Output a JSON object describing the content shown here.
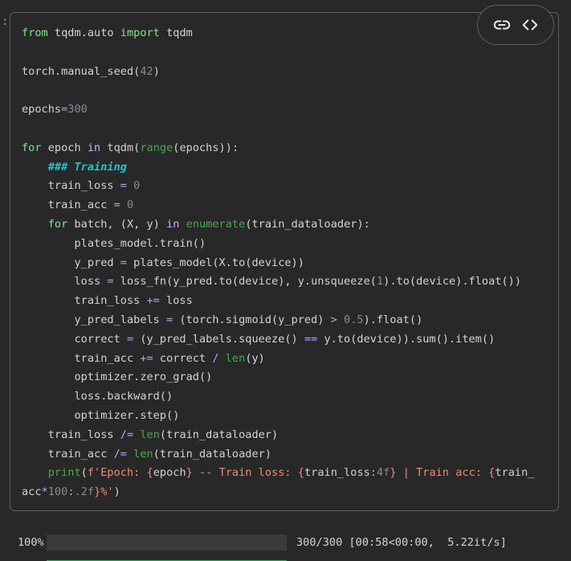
{
  "cell": {
    "prompt": ":",
    "lines": [
      [
        [
          "kw",
          "from"
        ],
        [
          "id",
          " tqdm.auto "
        ],
        [
          "kw",
          "import"
        ],
        [
          "id",
          " tqdm"
        ]
      ],
      [],
      [
        [
          "id",
          "torch.manual_seed("
        ],
        [
          "num",
          "42"
        ],
        [
          "id",
          ")"
        ]
      ],
      [],
      [
        [
          "id",
          "epochs"
        ],
        [
          "op",
          "="
        ],
        [
          "num",
          "300"
        ]
      ],
      [],
      [
        [
          "kw",
          "for"
        ],
        [
          "id",
          " epoch "
        ],
        [
          "kw2",
          "in"
        ],
        [
          "id",
          " tqdm("
        ],
        [
          "bi",
          "range"
        ],
        [
          "id",
          "(epochs)):"
        ]
      ],
      [
        [
          "id",
          "    "
        ],
        [
          "com",
          "### Training"
        ]
      ],
      [
        [
          "id",
          "    train_loss "
        ],
        [
          "op",
          "="
        ],
        [
          "id",
          " "
        ],
        [
          "num",
          "0"
        ]
      ],
      [
        [
          "id",
          "    train_acc "
        ],
        [
          "op",
          "="
        ],
        [
          "id",
          " "
        ],
        [
          "num",
          "0"
        ]
      ],
      [
        [
          "id",
          "    "
        ],
        [
          "kw",
          "for"
        ],
        [
          "id",
          " batch, (X, y) "
        ],
        [
          "kw2",
          "in"
        ],
        [
          "id",
          " "
        ],
        [
          "bi",
          "enumerate"
        ],
        [
          "id",
          "(train_dataloader):"
        ]
      ],
      [
        [
          "id",
          "        plates_model.train()"
        ]
      ],
      [
        [
          "id",
          "        y_pred "
        ],
        [
          "op",
          "="
        ],
        [
          "id",
          " plates_model(X.to(device))"
        ]
      ],
      [
        [
          "id",
          "        loss "
        ],
        [
          "op",
          "="
        ],
        [
          "id",
          " loss_fn(y_pred.to(device), y.unsqueeze("
        ],
        [
          "num",
          "1"
        ],
        [
          "id",
          ").to(device).float())"
        ]
      ],
      [
        [
          "id",
          "        train_loss "
        ],
        [
          "op",
          "+="
        ],
        [
          "id",
          " loss"
        ]
      ],
      [
        [
          "id",
          "        y_pred_labels "
        ],
        [
          "op",
          "="
        ],
        [
          "id",
          " (torch.sigmoid(y_pred) "
        ],
        [
          "op",
          ">"
        ],
        [
          "id",
          " "
        ],
        [
          "num",
          "0.5"
        ],
        [
          "id",
          ").float()"
        ]
      ],
      [
        [
          "id",
          "        correct "
        ],
        [
          "op",
          "="
        ],
        [
          "id",
          " (y_pred_labels.squeeze() "
        ],
        [
          "op",
          "=="
        ],
        [
          "id",
          " y.to(device)).sum().item()"
        ]
      ],
      [
        [
          "id",
          "        train_acc "
        ],
        [
          "op",
          "+="
        ],
        [
          "id",
          " correct "
        ],
        [
          "op",
          "/"
        ],
        [
          "id",
          " "
        ],
        [
          "bi",
          "len"
        ],
        [
          "id",
          "(y)"
        ]
      ],
      [
        [
          "id",
          "        optimizer.zero_grad()"
        ]
      ],
      [
        [
          "id",
          "        loss.backward()"
        ]
      ],
      [
        [
          "id",
          "        optimizer.step()"
        ]
      ],
      [
        [
          "id",
          "    train_loss "
        ],
        [
          "op",
          "/="
        ],
        [
          "id",
          " "
        ],
        [
          "bi",
          "len"
        ],
        [
          "id",
          "(train_dataloader)"
        ]
      ],
      [
        [
          "id",
          "    train_acc "
        ],
        [
          "op",
          "/="
        ],
        [
          "id",
          " "
        ],
        [
          "bi",
          "len"
        ],
        [
          "id",
          "(train_dataloader)"
        ]
      ],
      [
        [
          "id",
          "    "
        ],
        [
          "bi",
          "print"
        ],
        [
          "id",
          "("
        ],
        [
          "str",
          "f'Epoch: "
        ],
        [
          "str",
          "{"
        ],
        [
          "id",
          "epoch"
        ],
        [
          "str",
          "}"
        ],
        [
          "str",
          " -- Train loss: "
        ],
        [
          "str",
          "{"
        ],
        [
          "id",
          "train_loss"
        ],
        [
          "op",
          ":"
        ],
        [
          "num",
          "4f"
        ],
        [
          "str",
          "}"
        ],
        [
          "str",
          " | Train acc: "
        ],
        [
          "str",
          "{"
        ],
        [
          "id",
          "train_"
        ]
      ],
      [
        [
          "id",
          "acc"
        ],
        [
          "op",
          "*"
        ],
        [
          "num",
          "100"
        ],
        [
          "op",
          ":"
        ],
        [
          "num",
          ".2f"
        ],
        [
          "str",
          "}"
        ],
        [
          "str",
          "%'"
        ],
        [
          "id",
          ")"
        ]
      ]
    ]
  },
  "toolbar": {
    "link_icon": "link-icon",
    "code_icon": "code-icon"
  },
  "output": {
    "percent": "100%",
    "progress_fraction": 1.0,
    "stats": "300/300 [00:58<00:00,  5.22it/s]",
    "bar_color": "#2fad56"
  }
}
